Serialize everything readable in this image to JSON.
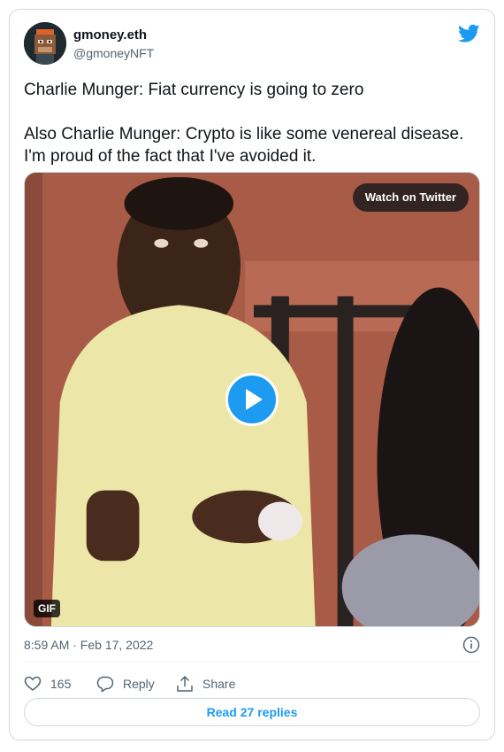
{
  "author": {
    "display_name": "gmoney.eth",
    "handle": "@gmoneyNFT",
    "avatar_icon": "pixel-ape-avatar"
  },
  "tweet": {
    "text": "Charlie Munger:  Fiat currency is going to zero\n\nAlso Charlie Munger: Crypto is like some venereal disease. I'm proud of the fact that I've avoided it."
  },
  "media": {
    "watch_label": "Watch on Twitter",
    "badge": "GIF",
    "play_icon": "play-icon"
  },
  "meta": {
    "timestamp": "8:59 AM · Feb 17, 2022"
  },
  "actions": {
    "like_count": "165",
    "reply_label": "Reply",
    "share_label": "Share"
  },
  "footer": {
    "read_replies_label": "Read 27 replies"
  },
  "colors": {
    "accent": "#1d9bf0",
    "text_primary": "#0f1419",
    "text_secondary": "#536471",
    "border": "#cfd9de"
  }
}
